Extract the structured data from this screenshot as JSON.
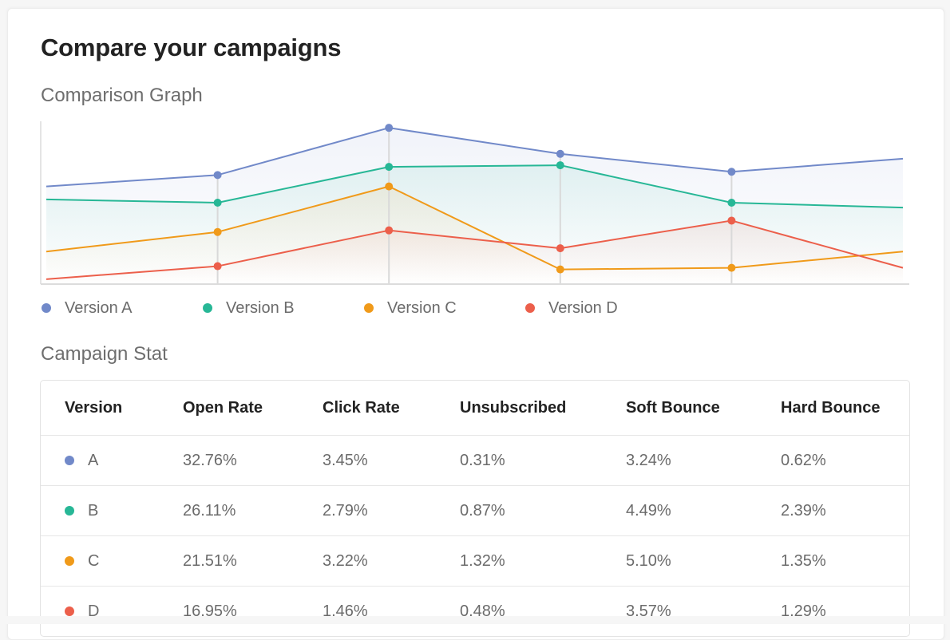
{
  "page": {
    "title": "Compare your campaigns",
    "graph_heading": "Comparison Graph",
    "stat_heading": "Campaign Stat"
  },
  "colors": {
    "A": "#7189c9",
    "B": "#27b796",
    "C": "#f09a1a",
    "D": "#ec5f4b",
    "grid": "#d9d9d9"
  },
  "chart_data": {
    "type": "area",
    "title": "Comparison Graph",
    "xlabel": "",
    "ylabel": "",
    "x": [
      1,
      2,
      3,
      4,
      5,
      6
    ],
    "ylim": [
      0,
      100
    ],
    "grid": "vertical lines at data points",
    "legend": "bottom-left",
    "note": "No axis tick labels shown; values are relative (0-100) estimates read from the plot.",
    "series": [
      {
        "name": "Version A",
        "key": "A",
        "values": [
          60,
          67,
          96,
          80,
          69,
          77
        ],
        "markers": [
          false,
          true,
          true,
          true,
          true,
          false
        ]
      },
      {
        "name": "Version B",
        "key": "B",
        "values": [
          52,
          50,
          72,
          73,
          50,
          47
        ],
        "markers": [
          false,
          true,
          true,
          true,
          true,
          false
        ]
      },
      {
        "name": "Version C",
        "key": "C",
        "values": [
          20,
          32,
          60,
          9,
          10,
          20
        ],
        "markers": [
          false,
          true,
          true,
          true,
          true,
          false
        ]
      },
      {
        "name": "Version D",
        "key": "D",
        "values": [
          3,
          11,
          33,
          22,
          39,
          10
        ],
        "markers": [
          false,
          true,
          true,
          true,
          true,
          false
        ]
      }
    ]
  },
  "legend": [
    {
      "key": "A",
      "label": "Version A"
    },
    {
      "key": "B",
      "label": "Version B"
    },
    {
      "key": "C",
      "label": "Version C"
    },
    {
      "key": "D",
      "label": "Version D"
    }
  ],
  "table": {
    "headers": [
      "Version",
      "Open Rate",
      "Click Rate",
      "Unsubscribed",
      "Soft Bounce",
      "Hard Bounce"
    ],
    "rows": [
      {
        "key": "A",
        "version": "A",
        "open_rate": "32.76%",
        "click_rate": "3.45%",
        "unsubscribed": "0.31%",
        "soft_bounce": "3.24%",
        "hard_bounce": "0.62%"
      },
      {
        "key": "B",
        "version": "B",
        "open_rate": "26.11%",
        "click_rate": "2.79%",
        "unsubscribed": "0.87%",
        "soft_bounce": "4.49%",
        "hard_bounce": "2.39%"
      },
      {
        "key": "C",
        "version": "C",
        "open_rate": "21.51%",
        "click_rate": "3.22%",
        "unsubscribed": "1.32%",
        "soft_bounce": "5.10%",
        "hard_bounce": "1.35%"
      },
      {
        "key": "D",
        "version": "D",
        "open_rate": "16.95%",
        "click_rate": "1.46%",
        "unsubscribed": "0.48%",
        "soft_bounce": "3.57%",
        "hard_bounce": "1.29%"
      }
    ]
  }
}
